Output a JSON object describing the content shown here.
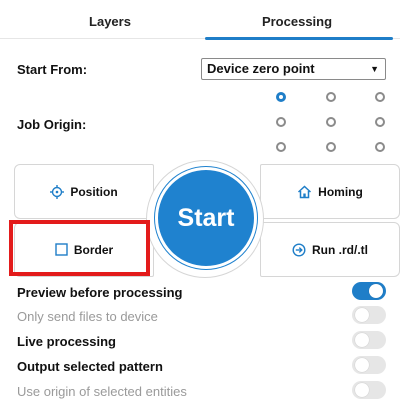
{
  "tabs": [
    {
      "label": "Layers"
    },
    {
      "label": "Processing"
    }
  ],
  "start_from": {
    "label": "Start From:",
    "selected": "Device zero point"
  },
  "job_origin": {
    "label": "Job Origin:",
    "selected_index": 0
  },
  "controls": {
    "position_label": "Position",
    "border_label": "Border",
    "start_label": "Start",
    "homing_label": "Homing",
    "run_label": "Run .rd/.tl"
  },
  "options": [
    {
      "label": "Preview before processing",
      "enabled": true,
      "on": true
    },
    {
      "label": "Only send files to device",
      "enabled": false,
      "on": false
    },
    {
      "label": "Live processing",
      "enabled": true,
      "on": false
    },
    {
      "label": "Output selected pattern",
      "enabled": true,
      "on": false
    },
    {
      "label": "Use origin of selected entities",
      "enabled": false,
      "on": false
    }
  ],
  "colors": {
    "accent": "#1f7ec8",
    "highlight": "#e31b1b"
  }
}
